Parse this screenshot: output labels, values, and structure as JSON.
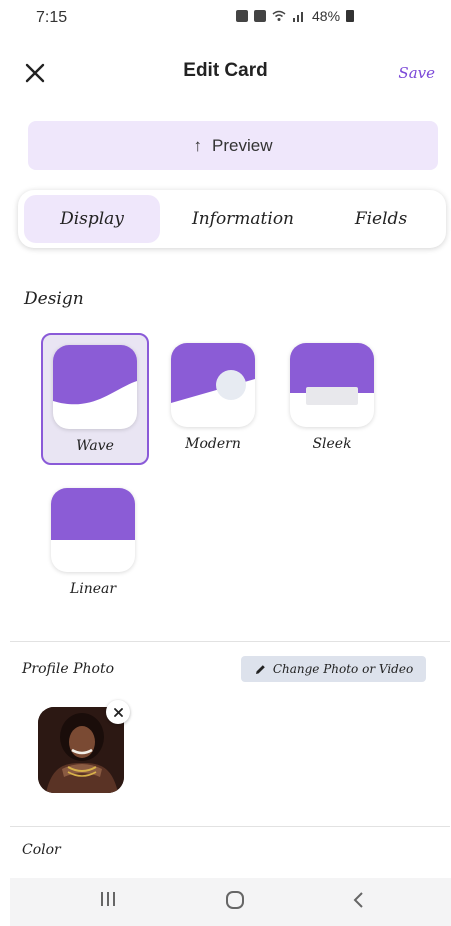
{
  "status_bar": {
    "time": "7:15",
    "battery_text": "48%",
    "icons": [
      "lock-icon",
      "alarm-icon",
      "wifi-icon",
      "signal-icon",
      "battery-icon"
    ]
  },
  "header": {
    "title": "Edit Card",
    "save_label": "Save",
    "close_icon": "close-icon"
  },
  "preview": {
    "arrow": "↑",
    "label": "Preview"
  },
  "tabs": [
    {
      "label": "Display",
      "active": true
    },
    {
      "label": "Information",
      "active": false
    },
    {
      "label": "Fields",
      "active": false
    }
  ],
  "design_section": {
    "title": "Design",
    "options": [
      {
        "label": "Wave",
        "selected": true
      },
      {
        "label": "Modern",
        "selected": false
      },
      {
        "label": "Sleek",
        "selected": false
      },
      {
        "label": "Linear",
        "selected": false
      }
    ]
  },
  "profile_photo": {
    "label": "Profile Photo",
    "change_label": "Change Photo or Video",
    "remove_icon": "close-icon"
  },
  "color_section": {
    "label": "Color"
  },
  "colors": {
    "accent": "#8b5cd6",
    "accent_light": "#efe7fb",
    "save_text": "#7b48d8"
  }
}
